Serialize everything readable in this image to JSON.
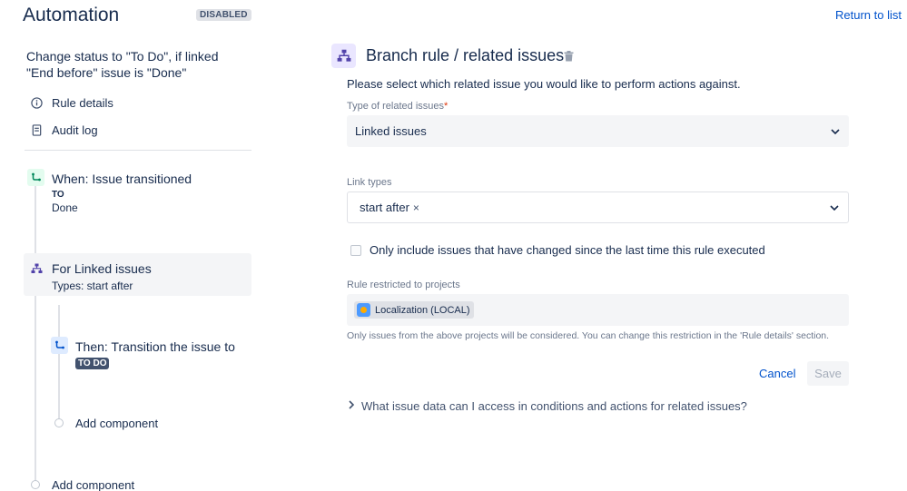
{
  "header": {
    "title": "Automation",
    "status_badge": "DISABLED",
    "return_link": "Return to list"
  },
  "sidebar": {
    "rule_name": "Change status to \"To Do\", if linked \"End before\" issue is \"Done\"",
    "links": [
      {
        "label": "Rule details",
        "icon": "info-icon"
      },
      {
        "label": "Audit log",
        "icon": "document-icon"
      }
    ],
    "components": {
      "trigger": {
        "title": "When: Issue transitioned",
        "to_label": "TO",
        "value": "Done"
      },
      "branch": {
        "title": "For Linked issues",
        "subtitle": "Types: start after"
      },
      "action": {
        "title": "Then: Transition the issue to",
        "status": "TO DO"
      },
      "add_inner": "Add component",
      "add_outer": "Add component"
    }
  },
  "panel": {
    "title": "Branch rule / related issues",
    "description": "Please select which related issue you would like to perform actions against.",
    "related_type": {
      "label": "Type of related issues",
      "required_mark": "*",
      "value": "Linked issues"
    },
    "link_types": {
      "label": "Link types",
      "chips": [
        "start after"
      ],
      "chip_remove": "×"
    },
    "checkbox_label": "Only include issues that have changed since the last time this rule executed",
    "restricted": {
      "label": "Rule restricted to projects",
      "project": "Localization (LOCAL)",
      "help": "Only issues from the above projects will be considered. You can change this restriction in the 'Rule details' section."
    },
    "cancel_label": "Cancel",
    "save_label": "Save",
    "expander_label": "What issue data can I access in conditions and actions for related issues?"
  },
  "colors": {
    "link": "#0052cc",
    "text": "#172b4d",
    "trigger_bg": "#e3fcef",
    "branch_bg": "#eae6ff",
    "action_bg": "#deebff",
    "lozenge": "#42526e"
  }
}
